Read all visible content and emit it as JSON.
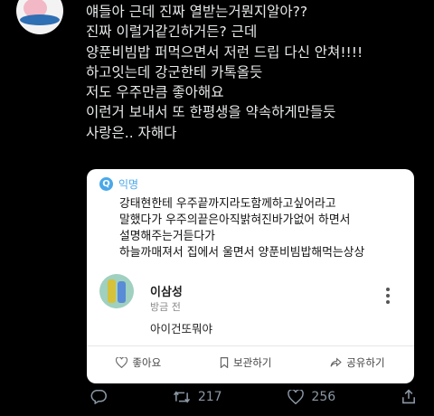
{
  "tweet": {
    "lines": [
      "얘들아 근데 진짜 열받는거뭔지알아??",
      "진짜 이럴거같긴하거든? 근데",
      "양푼비빔밥 퍼먹으면서 저런 드립 다신 안쳐!!!!",
      "하고잇는데 강군한테 카톡올듯",
      "저도 우주만큼 좋아해요",
      "이런거 보내서 또 한평생을 약속하게만들듯",
      "사랑은.. 자해다"
    ]
  },
  "card": {
    "source_icon": "Q",
    "source_label": "익명",
    "body_lines": [
      "강태현한테 우주끝까지라도함께하고싶어라고",
      "말했다가 우주의끝은아직밝혀진바가없어 하면서",
      "설명해주는거듣다가",
      "하늘까매져서 집에서 울면서 양푼비빔밥해먹는상상"
    ],
    "comment": {
      "name": "이삼성",
      "time": "방금 전",
      "text": "아이건또뭐야"
    },
    "actions": {
      "like": "좋아요",
      "bookmark": "보관하기",
      "share": "공유하기"
    }
  },
  "tweet_actions": {
    "retweets": "217",
    "likes": "256"
  },
  "colors": {
    "background": "#000000",
    "accent": "#4aa8e8",
    "text": "#e7e9ea",
    "muted": "#8b98a5"
  }
}
